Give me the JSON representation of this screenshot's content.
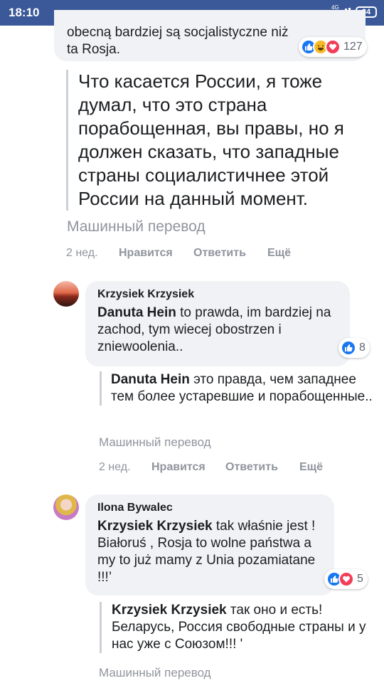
{
  "status_bar": {
    "time": "18:10",
    "dots": "•••",
    "network": "4G",
    "battery": "84"
  },
  "comments": [
    {
      "original_text": "obecną bardziej są socjalistyczne niż ta Rosja.",
      "reaction_count": "127",
      "translation": "Что касается России, я тоже думал, что это страна порабощенная, вы правы, но я должен сказать, что западные страны социалистичнее этой России на данный момент.",
      "machine_translation_label": "Машинный перевод",
      "time": "2 нед.",
      "like": "Нравится",
      "reply": "Ответить",
      "more": "Ещё"
    },
    {
      "author": "Krzysiek Krzysiek",
      "mention": "Danuta Hein",
      "text": " to prawda, im bardziej na zachod, tym wiecej obostrzen i zniewoolenia..",
      "reaction_count": "8",
      "translation_mention": "Danuta Hein",
      "translation": " это правда, чем западнее тем более устаревшие и порабощенные..",
      "machine_translation_label": "Машинный перевод",
      "time": "2 нед.",
      "like": "Нравится",
      "reply": "Ответить",
      "more": "Ещё"
    },
    {
      "author": "Ilona Bywalec",
      "mention": "Krzysiek Krzysiek",
      "text": " tak właśnie jest ! Białoruś , Rosja to wolne państwa a my to już mamy z Unia pozamiatane !!!’",
      "reaction_count": "5",
      "translation_mention": "Krzysiek Krzysiek",
      "translation": " так оно и есть! Беларусь, Россия свободные страны и у нас уже с Союзом!!! '",
      "machine_translation_label": "Машинный перевод"
    }
  ],
  "colors": {
    "header": "#3b5998",
    "like_blue": "#1877f2",
    "love_red": "#f33e58",
    "haha_yellow": "#f7b928"
  }
}
